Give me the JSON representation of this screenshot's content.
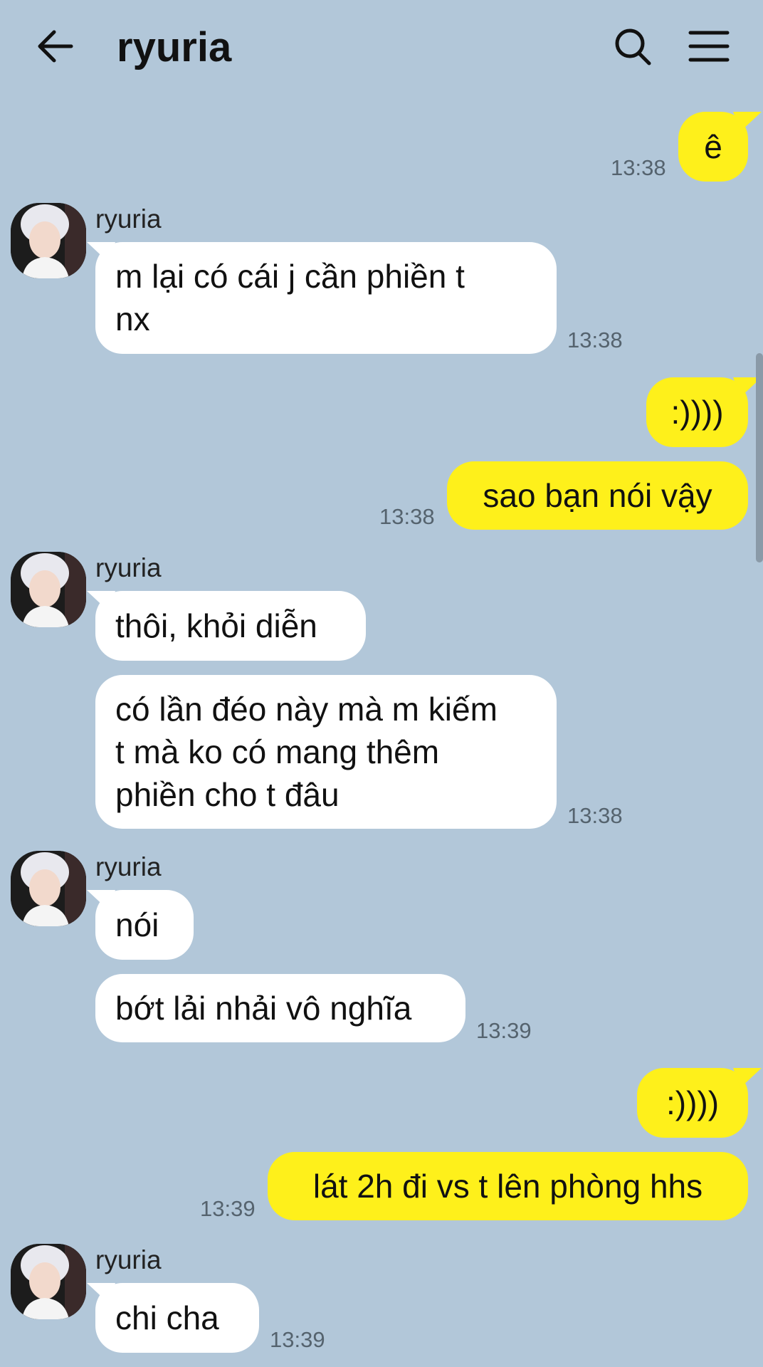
{
  "header": {
    "title": "ryuria",
    "back_icon": "back-arrow-icon",
    "search_icon": "search-icon",
    "menu_icon": "hamburger-menu-icon"
  },
  "colors": {
    "background": "#b2c7d9",
    "my_bubble": "#fef01b",
    "their_bubble": "#ffffff"
  },
  "messages": {
    "m1": {
      "text": "ê",
      "time": "13:38"
    },
    "g1": {
      "sender": "ryuria",
      "b1": {
        "lines": [
          "m lại có cái j cần phiền t",
          "nx"
        ],
        "time": "13:38"
      }
    },
    "m2": {
      "text": ":))))"
    },
    "m3": {
      "text": "sao bạn nói vậy",
      "time": "13:38"
    },
    "g2": {
      "sender": "ryuria",
      "b1": {
        "text": "thôi, khỏi diễn"
      },
      "b2": {
        "lines": [
          "có lần đéo này mà m kiếm",
          "t mà ko có mang thêm",
          "phiền cho t đâu"
        ],
        "time": "13:38"
      }
    },
    "g3": {
      "sender": "ryuria",
      "b1": {
        "text": "nói"
      },
      "b2": {
        "text": "bớt lải nhải vô nghĩa",
        "time": "13:39"
      }
    },
    "m4": {
      "text": ":))))"
    },
    "m5": {
      "text": "lát 2h đi vs t lên phòng hhs",
      "time": "13:39"
    },
    "g4": {
      "sender": "ryuria",
      "b1": {
        "text": "chi cha",
        "time": "13:39"
      }
    }
  }
}
